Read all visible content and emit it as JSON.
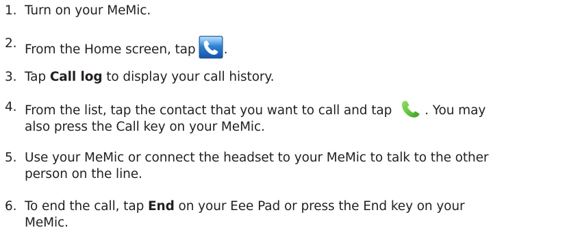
{
  "steps": [
    {
      "number": "1.",
      "text": "Turn on your MeMic."
    },
    {
      "number": "2.",
      "before": "From the Home screen, tap",
      "icon": "phone-app-icon",
      "after": "."
    },
    {
      "number": "3.",
      "before": "Tap ",
      "bold": "Call log",
      "after": " to display your call history."
    },
    {
      "number": "4.",
      "line1_before": "From the list, tap the contact that you want to call and tap",
      "icon": "green-call-handset-icon",
      "line1_after": ". You may",
      "line2": "also press the Call key on your MeMic."
    },
    {
      "number": "5.",
      "line1": "Use your MeMic or connect the headset to your MeMic to talk to the other",
      "line2": "person on the line."
    },
    {
      "number": "6.",
      "line1_before": "To end the call, tap ",
      "bold": "End",
      "line1_after": " on your Eee Pad or press the End key on your",
      "line2": "MeMic."
    }
  ],
  "colors": {
    "text": "#231f20",
    "phone_icon_blue": "#2a7fd4",
    "call_icon_green": "#5fc23a"
  }
}
